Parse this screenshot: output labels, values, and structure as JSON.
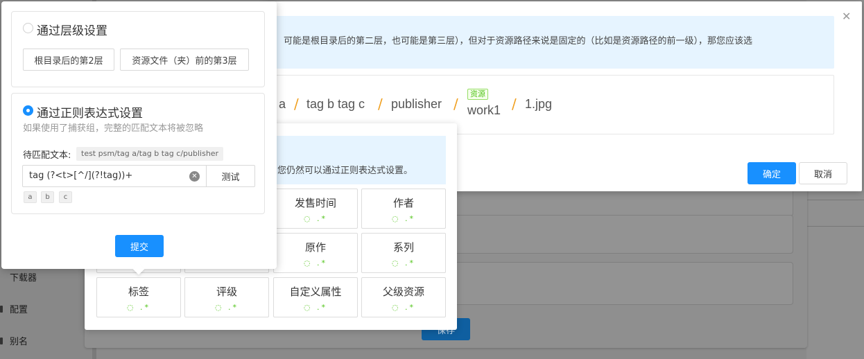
{
  "nav": {
    "items": [
      {
        "label": "下载器"
      },
      {
        "label": "配置"
      },
      {
        "label": "别名"
      }
    ]
  },
  "save_label": "保存",
  "path_dialog": {
    "tip": "可能是根目录后的第二层，也可能是第三层），但对于资源路径来说是固定的（比如是资源路径的前一级），那您应该选",
    "segments": [
      "a",
      "tag b tag c",
      "publisher",
      "work1",
      "1.jpg"
    ],
    "resource_tag": "资源",
    "ok_label": "确定",
    "cancel_label": "取消",
    "close_icon": "close-icon"
  },
  "picker": {
    "tip": "您仍然可以通过正则表达式设置。",
    "cells": [
      {
        "label": "发售时间"
      },
      {
        "label": "作者"
      },
      {
        "label": "原作"
      },
      {
        "label": "系列"
      },
      {
        "label": "标签"
      },
      {
        "label": "评级"
      },
      {
        "label": "自定义属性"
      },
      {
        "label": "父级资源"
      }
    ],
    "cell_icons": "◌ .*"
  },
  "popover": {
    "layer": {
      "title": "通过层级设置",
      "options": [
        "根目录后的第2层",
        "资源文件（夹）前的第3层"
      ],
      "selected": false
    },
    "regex": {
      "title": "通过正则表达式设置",
      "hint": "如果使用了捕获组，完整的匹配文本将被忽略",
      "match_label": "待匹配文本:",
      "match_text": "test psm/tag a/tag b tag c/publisher",
      "input_value": "tag (?<t>[^/](?!tag))+",
      "test_label": "测试",
      "groups": [
        "a",
        "b",
        "c"
      ],
      "selected": true
    },
    "submit_label": "提交"
  },
  "colors": {
    "primary": "#1890ff",
    "tip_bg": "#e6f4ff",
    "slash": "#f0a020",
    "tag_green": "#52c41a"
  }
}
